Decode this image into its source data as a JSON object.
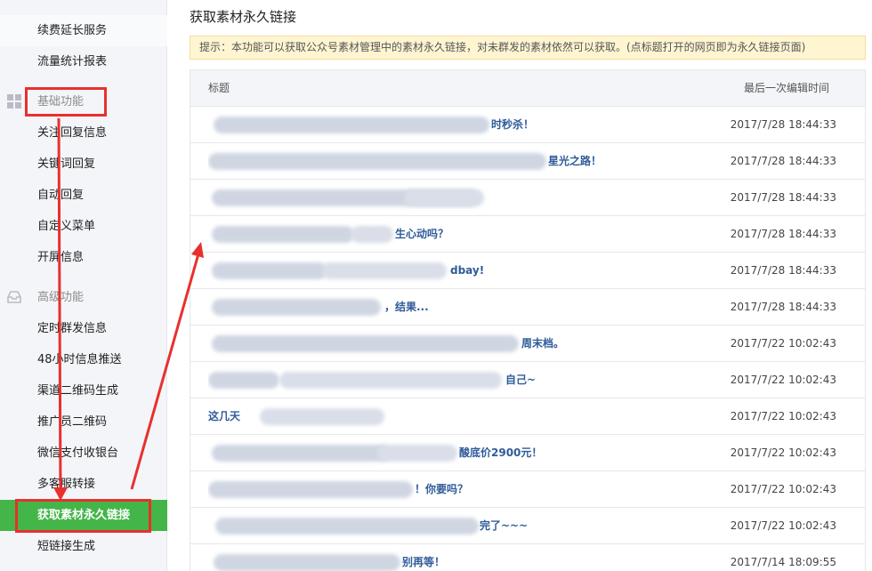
{
  "sidebar": {
    "top_items": [
      "续费延长服务",
      "流量统计报表"
    ],
    "group_basic": "基础功能",
    "basic_items": [
      "关注回复信息",
      "关键词回复",
      "自动回复",
      "自定义菜单",
      "开屏信息"
    ],
    "group_advanced": "高级功能",
    "advanced_items": [
      "定时群发信息",
      "48小时信息推送",
      "渠道二维码生成",
      "推广员二维码",
      "微信支付收银台",
      "多客服转接",
      "获取素材永久链接",
      "短链接生成"
    ],
    "active_item": "获取素材永久链接",
    "accent": "#44b549"
  },
  "main": {
    "title": "获取素材永久链接",
    "notice": "提示：本功能可以获取公众号素材管理中的素材永久链接，对未群发的素材依然可以获取。(点标题打开的网页即为永久链接页面)",
    "table": {
      "col_title": "标题",
      "col_time": "最后一次编辑时间",
      "rows": [
        {
          "title": "时秒杀！",
          "time": "2017/7/28 18:44:33"
        },
        {
          "title": "星光之路！",
          "time": "2017/7/28 18:44:33"
        },
        {
          "title": "",
          "time": "2017/7/28 18:44:33"
        },
        {
          "title": "生心动吗？",
          "time": "2017/7/28 18:44:33"
        },
        {
          "title": "dbay!",
          "time": "2017/7/28 18:44:33"
        },
        {
          "title": "，结果...",
          "time": "2017/7/28 18:44:33"
        },
        {
          "title": "周末档。",
          "time": "2017/7/22 10:02:43"
        },
        {
          "title": "自己~",
          "time": "2017/7/22 10:02:43"
        },
        {
          "title": "这几天",
          "time": "2017/7/22 10:02:43"
        },
        {
          "title": "酸底价2900元！",
          "time": "2017/7/22 10:02:43"
        },
        {
          "title": "！你要吗？",
          "time": "2017/7/22 10:02:43"
        },
        {
          "title": "完了~~~",
          "time": "2017/7/22 10:02:43"
        },
        {
          "title": "别再等！",
          "time": "2017/7/14 18:09:55"
        }
      ]
    }
  }
}
